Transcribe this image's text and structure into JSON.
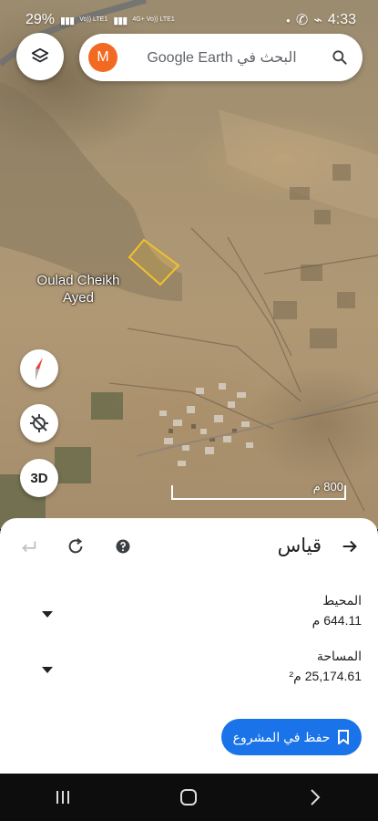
{
  "status_bar": {
    "battery": "29%",
    "time": "4:33",
    "sim1": "Vo)) LTE1",
    "sim2": "4G+ Vo)) LTE1"
  },
  "search": {
    "avatar_letter": "M",
    "placeholder": "البحث في Google Earth"
  },
  "map": {
    "place_label": "Oulad Cheikh Ayed",
    "scale_label": "800 م",
    "three_d_label": "3D",
    "polygon_color": "#f2c12e"
  },
  "panel": {
    "title": "قياس",
    "perimeter_label": "المحيط",
    "perimeter_value": "644.11 م",
    "area_label": "المساحة",
    "area_value": "25,174.61 م²",
    "save_label": "حفظ في المشروع"
  },
  "colors": {
    "accent": "#1a73e8",
    "avatar": "#f26a21"
  }
}
